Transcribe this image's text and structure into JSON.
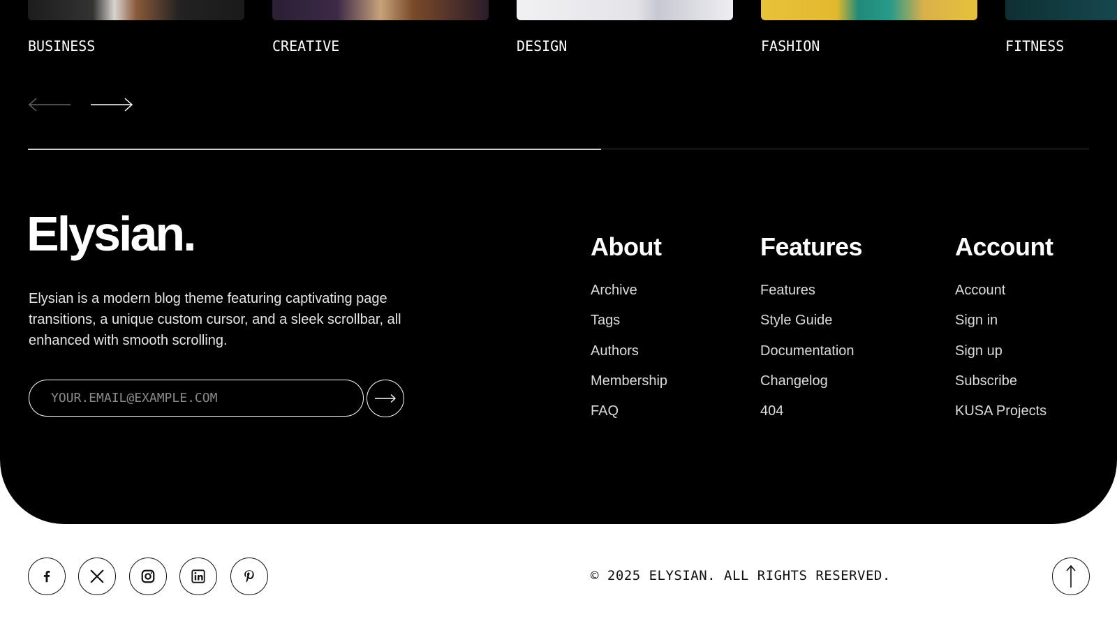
{
  "categories": [
    {
      "label": "BUSINESS",
      "thumb_color": "#2a2a2a"
    },
    {
      "label": "CREATIVE",
      "thumb_color": "#3a2a3c"
    },
    {
      "label": "DESIGN",
      "thumb_color": "#e2e2e6"
    },
    {
      "label": "FASHION",
      "thumb_color": "#e6c23a"
    },
    {
      "label": "FITNESS",
      "thumb_color": "#0f3a3f"
    }
  ],
  "carousel": {
    "prev_icon": "arrow-left-icon",
    "next_icon": "arrow-right-icon",
    "progress_fraction": 0.54
  },
  "footer": {
    "brand": "Elysian.",
    "description": "Elysian is a modern blog theme featuring captivating page transitions, a unique custom cursor, and a sleek scrollbar, all enhanced with smooth scrolling.",
    "newsletter": {
      "placeholder": "YOUR.EMAIL@EXAMPLE.COM",
      "submit_icon": "arrow-right-icon"
    },
    "columns": [
      {
        "heading": "About",
        "links": [
          "Archive",
          "Tags",
          "Authors",
          "Membership",
          "FAQ"
        ]
      },
      {
        "heading": "Features",
        "links": [
          "Features",
          "Style Guide",
          "Documentation",
          "Changelog",
          "404"
        ]
      },
      {
        "heading": "Account",
        "links": [
          "Account",
          "Sign in",
          "Sign up",
          "Subscribe",
          "KUSA Projects"
        ]
      }
    ]
  },
  "bottom_bar": {
    "social_icons": [
      "facebook-icon",
      "x-icon",
      "instagram-icon",
      "linkedin-icon",
      "pinterest-icon"
    ],
    "copyright": "© 2025 ELYSIAN. ALL RIGHTS RESERVED.",
    "back_to_top_icon": "arrow-up-icon"
  },
  "colors": {
    "background_dark": "#000000",
    "background_light": "#ffffff",
    "text_light": "#ffffff",
    "text_dark": "#111111"
  }
}
